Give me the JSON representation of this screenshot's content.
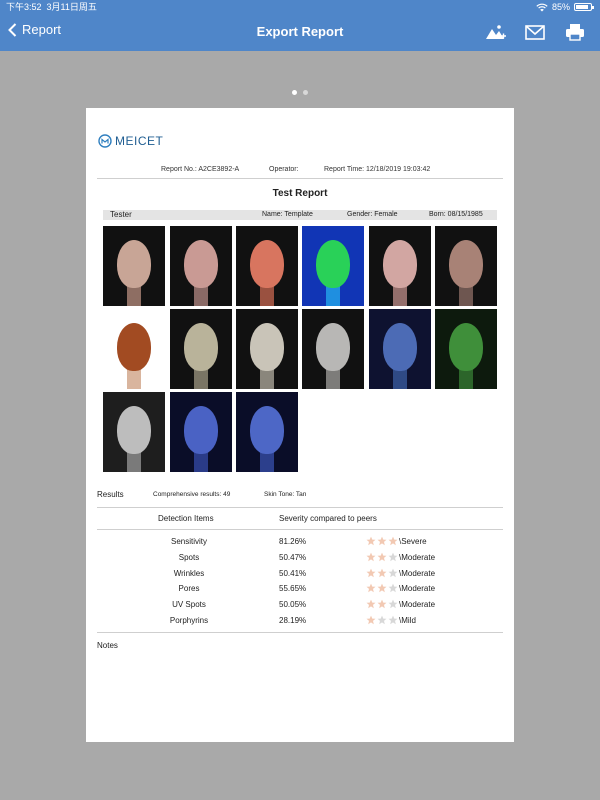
{
  "status": {
    "time": "下午3:52",
    "date": "3月11日周五",
    "battery": "85%"
  },
  "nav": {
    "back_label": "Report",
    "title": "Export Report"
  },
  "pager": {
    "pages": 2,
    "current": 1
  },
  "report": {
    "logo": "MEICET",
    "report_no": "Report No.: A2CE3892-A",
    "operator": "Operator:",
    "report_time": "Report Time: 12/18/2019 19:03:42",
    "title": "Test Report",
    "tester_label": "Tester",
    "name": "Name: Template",
    "gender": "Gender: Female",
    "born": "Born: 08/15/1985"
  },
  "photos": [
    {
      "name": "photo-white-light",
      "bg": "#111111",
      "face": "#c8a596",
      "neck": "#8e6e63"
    },
    {
      "name": "photo-cross-polarized",
      "bg": "#111111",
      "face": "#c99a94",
      "neck": "#8a6a66"
    },
    {
      "name": "photo-red-zone",
      "bg": "#111111",
      "face": "#d8755f",
      "neck": "#9a5140"
    },
    {
      "name": "photo-heatmap",
      "bg": "#1135b5",
      "face": "#29d158",
      "neck": "#1f8fe0"
    },
    {
      "name": "photo-parallel-polarized",
      "bg": "#111111",
      "face": "#d2a6a2",
      "neck": "#946f6c"
    },
    {
      "name": "photo-brown-zone",
      "bg": "#111111",
      "face": "#a88276",
      "neck": "#6e5650"
    },
    {
      "name": "photo-texture-map",
      "bg": "#ffffff",
      "face": "#a24b22",
      "neck": "#d9b59e"
    },
    {
      "name": "photo-standard-light-2",
      "bg": "#111111",
      "face": "#b9b39a",
      "neck": "#7a7565"
    },
    {
      "name": "photo-standard-light-3",
      "bg": "#111111",
      "face": "#c9c4b8",
      "neck": "#8a867c"
    },
    {
      "name": "photo-standard-light-4",
      "bg": "#111111",
      "face": "#b8b7b5",
      "neck": "#7d7c7a"
    },
    {
      "name": "photo-uv-blue",
      "bg": "#0e1230",
      "face": "#4c6bb5",
      "neck": "#2f4a85"
    },
    {
      "name": "photo-uv-green",
      "bg": "#0d1a0d",
      "face": "#3f8f3a",
      "neck": "#2c652a"
    },
    {
      "name": "photo-grayscale-wrinkle",
      "bg": "#1e1e1e",
      "face": "#bdbdbd",
      "neck": "#7a7a7a"
    },
    {
      "name": "photo-wood-lamp",
      "bg": "#0a0d28",
      "face": "#4a62c4",
      "neck": "#2a3b88"
    },
    {
      "name": "photo-wood-lamp-2",
      "bg": "#0a0d28",
      "face": "#4d67c6",
      "neck": "#2c3f8c"
    }
  ],
  "results": {
    "label": "Results",
    "comprehensive": "Comprehensive results: 49",
    "skin_tone": "Skin Tone: Tan",
    "col_items": "Detection Items",
    "col_severity": "Severity compared to peers",
    "rows": [
      {
        "item": "Sensitivity",
        "pct": "81.26%",
        "stars": 3,
        "severity": "\\Severe"
      },
      {
        "item": "Spots",
        "pct": "50.47%",
        "stars": 2,
        "severity": "\\Moderate"
      },
      {
        "item": "Wrinkles",
        "pct": "50.41%",
        "stars": 2,
        "severity": "\\Moderate"
      },
      {
        "item": "Pores",
        "pct": "55.65%",
        "stars": 2,
        "severity": "\\Moderate"
      },
      {
        "item": "UV Spots",
        "pct": "50.05%",
        "stars": 2,
        "severity": "\\Moderate"
      },
      {
        "item": "Porphyrins",
        "pct": "28.19%",
        "stars": 1,
        "severity": "\\Mild"
      }
    ]
  },
  "notes": {
    "label": "Notes"
  },
  "colors": {
    "nav_bg": "#4f86c9",
    "star_on": "#f2c9b3",
    "star_off": "#d8d8d8",
    "backdrop": "#a9a9a9"
  }
}
